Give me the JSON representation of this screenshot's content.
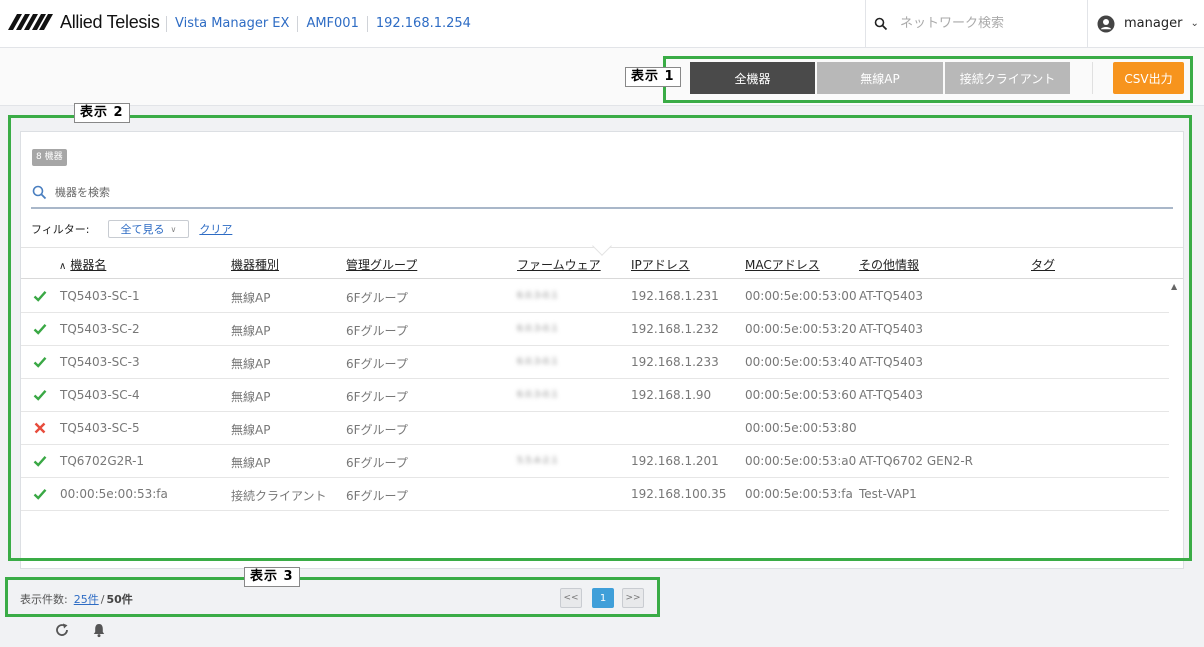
{
  "header": {
    "logo_text": "Allied Telesis",
    "crumbs": [
      "Vista Manager EX",
      "AMF001",
      "192.168.1.254"
    ],
    "search_placeholder": "ネットワーク検索",
    "user_name": "manager"
  },
  "toolbar": {
    "tabs": [
      "全機器",
      "無線AP",
      "接続クライアント"
    ],
    "active_tab": "全機器",
    "csv_label": "CSV出力"
  },
  "annotations": [
    "表示 1",
    "表示 2",
    "表示 3"
  ],
  "panel": {
    "count_badge": "8 機器",
    "search_placeholder": "機器を検索",
    "filter_label": "フィルター:",
    "filter_value": "全て見る",
    "clear_label": "クリア",
    "columns": [
      "機器名",
      "機器種別",
      "管理グループ",
      "ファームウェア",
      "IPアドレス",
      "MACアドレス",
      "その他情報",
      "タグ"
    ],
    "sorted_column": "機器名",
    "rows": [
      {
        "status": "ok",
        "name": "TQ5403-SC-1",
        "type": "無線AP",
        "group": "6Fグループ",
        "firmware": "6.0.3-0.1",
        "ip": "192.168.1.231",
        "mac": "00:00:5e:00:53:00",
        "info": "AT-TQ5403",
        "tag": ""
      },
      {
        "status": "ok",
        "name": "TQ5403-SC-2",
        "type": "無線AP",
        "group": "6Fグループ",
        "firmware": "6.0.3-0.1",
        "ip": "192.168.1.232",
        "mac": "00:00:5e:00:53:20",
        "info": "AT-TQ5403",
        "tag": ""
      },
      {
        "status": "ok",
        "name": "TQ5403-SC-3",
        "type": "無線AP",
        "group": "6Fグループ",
        "firmware": "6.0.3-0.1",
        "ip": "192.168.1.233",
        "mac": "00:00:5e:00:53:40",
        "info": "AT-TQ5403",
        "tag": ""
      },
      {
        "status": "ok",
        "name": "TQ5403-SC-4",
        "type": "無線AP",
        "group": "6Fグループ",
        "firmware": "6.0.3-0.1",
        "ip": "192.168.1.90",
        "mac": "00:00:5e:00:53:60",
        "info": "AT-TQ5403",
        "tag": ""
      },
      {
        "status": "error",
        "name": "TQ5403-SC-5",
        "type": "無線AP",
        "group": "6Fグループ",
        "firmware": "",
        "ip": "",
        "mac": "00:00:5e:00:53:80",
        "info": "",
        "tag": ""
      },
      {
        "status": "ok",
        "name": "TQ6702G2R-1",
        "type": "無線AP",
        "group": "6Fグループ",
        "firmware": "5.5.4-2.1",
        "ip": "192.168.1.201",
        "mac": "00:00:5e:00:53:a0",
        "info": "AT-TQ6702 GEN2-R",
        "tag": ""
      },
      {
        "status": "ok",
        "name": "00:00:5e:00:53:fa",
        "type": "接続クライアント",
        "group": "6Fグループ",
        "firmware": "",
        "ip": "192.168.100.35",
        "mac": "00:00:5e:00:53:fa",
        "info": "Test-VAP1",
        "tag": ""
      }
    ]
  },
  "footer": {
    "page_size_label": "表示件数:",
    "page_size": "25件",
    "total": "50件",
    "prev": "<<",
    "current_page": "1",
    "next": ">>"
  },
  "colors": {
    "accent_blue": "#2e6cc4",
    "csv_orange": "#f7941d",
    "annotation_green": "#3aac46",
    "ok_green": "#3aa845",
    "error_red": "#e74c3c",
    "tab_active": "#4a4a4a",
    "tab_inactive": "#b8b8b8"
  },
  "icons": [
    "search-icon",
    "user-icon",
    "chevron-down-icon",
    "check-icon",
    "cross-icon",
    "refresh-icon",
    "bell-icon"
  ]
}
